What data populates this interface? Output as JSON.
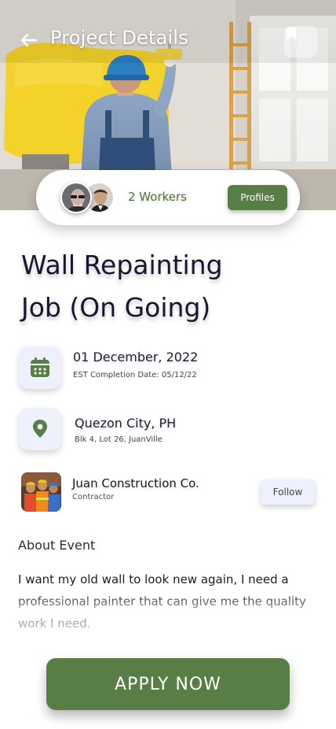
{
  "header": {
    "title": "Project Details",
    "back_icon": "arrow-left-icon",
    "bookmark_icon": "bookmark-icon"
  },
  "workers": {
    "count_label": "2 Workers",
    "profiles_label": "Profiles"
  },
  "job": {
    "title_line1": "Wall Repainting",
    "title_line2": "Job (On Going)"
  },
  "schedule": {
    "date": "01 December, 2022",
    "completion": "EST Completion Date: 05/12/22",
    "icon": "calendar-icon"
  },
  "location": {
    "city": "Quezon City, PH",
    "address": "Blk 4, Lot 26, JuanVille",
    "icon": "location-pin-icon"
  },
  "contractor": {
    "name": "Juan Construction Co.",
    "role": "Contractor",
    "follow_label": "Follow"
  },
  "about": {
    "heading": "About Event",
    "text": "I want my old wall to look new again, I need a professional painter that can give me the quality work I need."
  },
  "apply": {
    "label": "APPLY NOW"
  },
  "colors": {
    "accent": "#587d45",
    "icon_bg": "#eef0fb",
    "text_dark": "#1a1530"
  }
}
